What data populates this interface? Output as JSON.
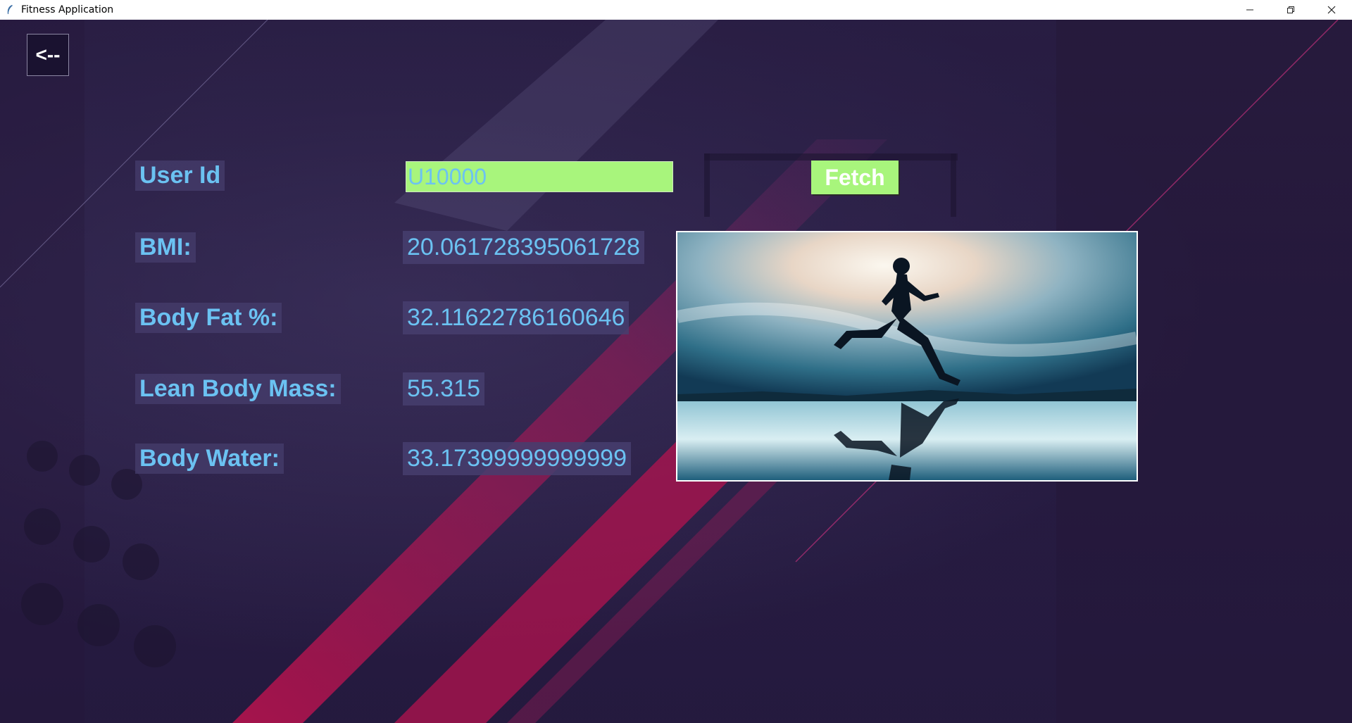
{
  "window": {
    "title": "Fitness Application",
    "minimize_glyph": "—",
    "restore_glyph": "❐",
    "close_glyph": "✕"
  },
  "back_button": {
    "label": "<--"
  },
  "form": {
    "user_id_label": "User Id",
    "user_id_value": "U10000",
    "fetch_label": "Fetch"
  },
  "metrics": [
    {
      "label": "BMI:",
      "value": "20.061728395061728"
    },
    {
      "label": "Body Fat %:",
      "value": "32.11622786160646"
    },
    {
      "label": "Lean Body Mass:",
      "value": "55.315"
    },
    {
      "label": "Body Water:",
      "value": "33.17399999999999"
    }
  ],
  "colors": {
    "label_text": "#6bc2f2",
    "input_bg": "#a8f57c",
    "accent_stripe": "#b3134f",
    "background": "#2a1d45"
  },
  "image": {
    "subject": "runner-silhouette-reflection"
  }
}
